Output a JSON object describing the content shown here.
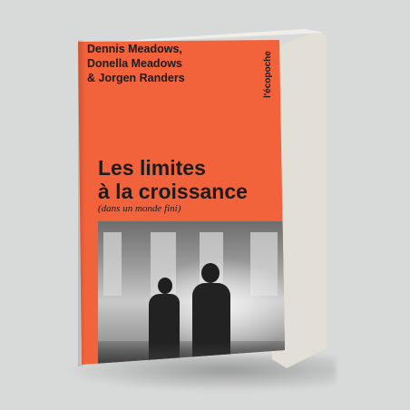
{
  "book": {
    "authors": [
      "Dennis Meadows,",
      "Donella Meadows",
      "& Jorgen Randers"
    ],
    "publisher": "l'écopoche",
    "title_lines": [
      "Les limites",
      "à la croissance"
    ],
    "subtitle": "(dans un monde fini)"
  },
  "colors": {
    "cover": "#f2633c",
    "background": "#d8d9d9",
    "text": "#1c1c1c"
  },
  "icons": []
}
